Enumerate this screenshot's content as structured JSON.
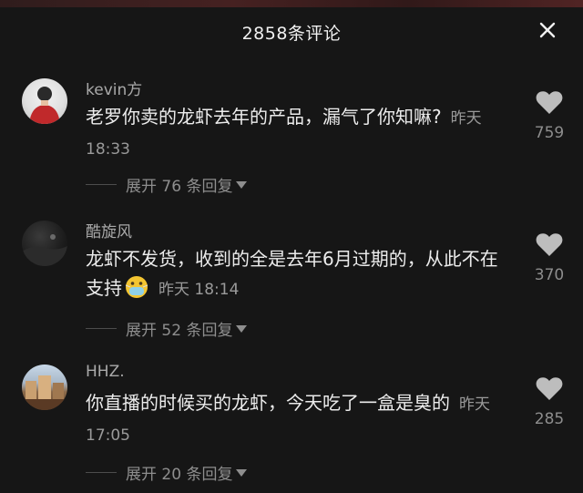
{
  "header": {
    "title": "2858条评论",
    "close_icon": "close-icon"
  },
  "comments": [
    {
      "username": "kevin方",
      "text": "老罗你卖的龙虾去年的产品，漏气了你知嘛?",
      "time": "昨天 18:33",
      "likes": "759",
      "replies": "展开 76 条回复",
      "emoji": ""
    },
    {
      "username": "酷旋风",
      "text": "龙虾不发货，收到的全是去年6月过期的，从此不在支持",
      "time": "昨天 18:14",
      "likes": "370",
      "replies": "展开 52 条回复",
      "emoji": "mask-face-emoji"
    },
    {
      "username": "HHZ.",
      "text": "你直播的时候买的龙虾，今天吃了一盒是臭的",
      "time": "昨天 17:05",
      "likes": "285",
      "replies": "展开 20 条回复",
      "emoji": ""
    }
  ],
  "colors": {
    "background": "#161616",
    "text": "#ececec",
    "secondary": "#9a9a9a",
    "heart": "#bdbdbd"
  }
}
